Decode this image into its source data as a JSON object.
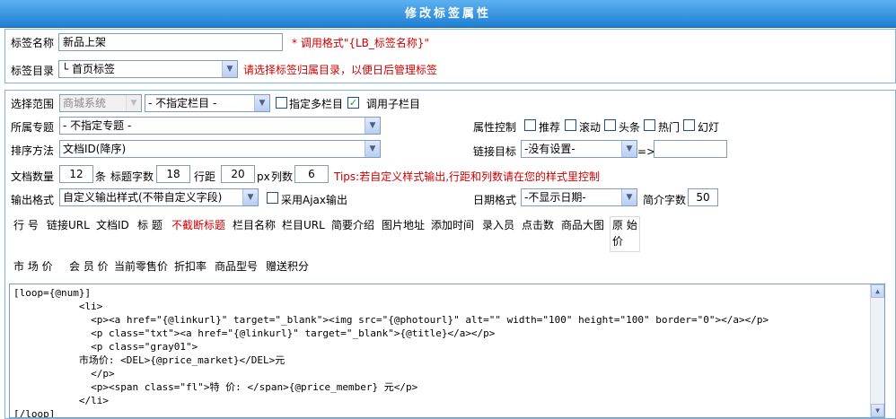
{
  "header": {
    "title": "修改标签属性"
  },
  "tag_name": {
    "label": "标签名称",
    "value": "新品上架",
    "hint": "* 调用格式\"{LB_标签名称}\""
  },
  "tag_dir": {
    "label": "标签目录",
    "value": "└  首页标签",
    "hint": "请选择标签归属目录，以便日后管理标签"
  },
  "scope": {
    "label": "选择范围",
    "system_value": "商城系统",
    "column_value": "- 不指定栏目 -",
    "multi_label": "指定多栏目",
    "sub_label": "调用子栏目"
  },
  "topic": {
    "label": "所属专题",
    "value": "- 不指定专题 -"
  },
  "attr": {
    "label": "属性控制",
    "options": [
      "推荐",
      "滚动",
      "头条",
      "热门",
      "幻灯"
    ]
  },
  "sort": {
    "label": "排序方法",
    "value": "文档ID(降序)"
  },
  "link_target": {
    "label": "链接目标",
    "value": "-没有设置-",
    "arrow": "=>",
    "custom": ""
  },
  "counts": {
    "doc_label": "文档数量",
    "doc_value": "12",
    "doc_unit": "条",
    "title_label": "标题字数",
    "title_value": "18",
    "row_label": "行距",
    "row_value": "20",
    "px_label": "px",
    "col_label": "列数",
    "col_value": "6",
    "tips": "Tips:若自定义样式输出,行距和列数请在您的样式里控制"
  },
  "output": {
    "label": "输出格式",
    "value": "自定义输出样式(不带自定义字段)",
    "ajax_label": "采用Ajax输出"
  },
  "date_format": {
    "label": "日期格式",
    "value": "-不显示日期-",
    "intro_label": "简介字数",
    "intro_value": "50"
  },
  "tags_row1": [
    "行 号",
    "链接URL",
    "文档ID",
    "标 题",
    "不截断标题",
    "栏目名称",
    "栏目URL",
    "简要介绍",
    "图片地址",
    "添加时间",
    "录入员",
    "点击数",
    "商品大图",
    "原 始",
    "价"
  ],
  "tags_row2": [
    "市 场 价",
    "会 员 价",
    "当前零售价",
    "折扣率",
    "商品型号",
    "赠送积分"
  ],
  "code": "[loop={@num}]\n           <li>\n             <p><a href=\"{@linkurl}\" target=\"_blank\"><img src=\"{@photourl}\" alt=\"\" width=\"100\" height=\"100\" border=\"0\"></a></p>\n             <p class=\"txt\"><a href=\"{@linkurl}\" target=\"_blank\">{@title}</a></p>\n             <p class=\"gray01\">\n           市场价: <DEL>{@price_market}</DEL>元\n             </p>\n             <p><span class=\"fl\">特 价: </span>{@price_member} 元</p>\n           </li>\n[/loop]",
  "colors": {
    "header_top": "#5bb1f0",
    "header_bottom": "#1f7fd4",
    "border": "#7fb2e3",
    "hint_red": "#d00000"
  }
}
